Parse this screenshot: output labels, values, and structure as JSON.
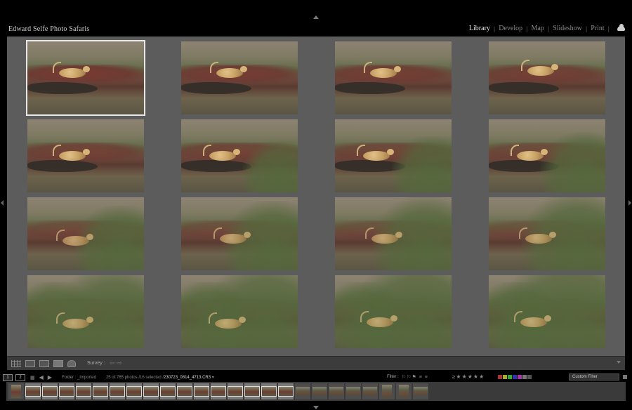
{
  "identity_plate": "Edward Selfe Photo Safaris",
  "modules": [
    {
      "label": "Library",
      "active": true
    },
    {
      "label": "Develop",
      "active": false
    },
    {
      "label": "Map",
      "active": false
    },
    {
      "label": "Slideshow",
      "active": false
    },
    {
      "label": "Print",
      "active": false
    }
  ],
  "grid": {
    "rows": 4,
    "columns": 4,
    "selected_index": 0,
    "total_thumbnails": 16
  },
  "toolbar": {
    "survey_label": "Survey :",
    "icons": [
      "grid-view-icon",
      "loupe-view-icon",
      "compare-view-icon",
      "survey-view-icon",
      "people-view-icon"
    ]
  },
  "filmstrip_bar": {
    "screen_1": "1",
    "screen_2": "2",
    "folder_label": "Folder : _Imported",
    "count_prefix": "25 of 765 photos /16 selected /",
    "filename": "230723_0814_4713.CR3",
    "filter_label": "Filter :",
    "custom_filter": "Custom Filter",
    "label_colors": [
      "#a33",
      "#aa3",
      "#3a3",
      "#33a",
      "#a3a",
      "#777",
      "#555"
    ]
  },
  "filmstrip": {
    "thumb_count": 25,
    "selected_count": 16
  }
}
